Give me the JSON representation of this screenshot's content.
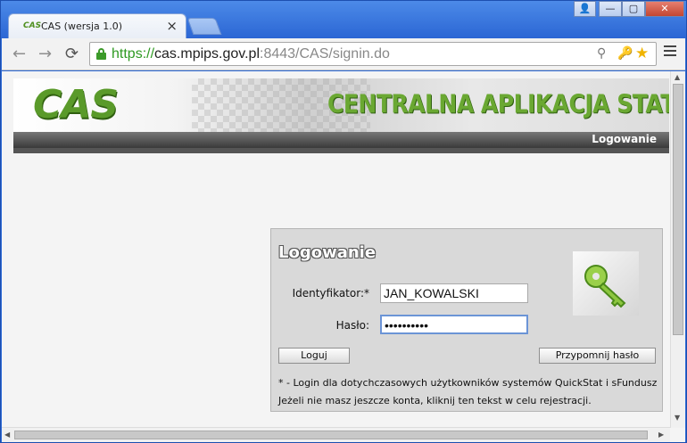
{
  "browser": {
    "tab": {
      "favicon_text": "CAS",
      "title": "CAS (wersja 1.0)",
      "close": "×"
    },
    "window_controls": {
      "user": "👤",
      "minimize": "—",
      "maximize": "▢",
      "close": "✕"
    },
    "nav": {
      "back": "←",
      "forward": "→",
      "reload": "⟳"
    },
    "url": {
      "scheme": "https://",
      "host": "cas.mpips.gov.pl",
      "rest": ":8443/CAS/signin.do"
    },
    "icons": {
      "zoom": "⚲",
      "key": "🔑",
      "star": "★"
    }
  },
  "page": {
    "logo": "CAS",
    "header_title": "CENTRALNA APLIKACJA STATYSTYCZNA",
    "header_bar_label": "Logowanie"
  },
  "login": {
    "title": "Logowanie",
    "id_label": "Identyfikator:*",
    "id_value": "JAN_KOWALSKI",
    "password_label": "Hasło:",
    "password_value": "••••••••••",
    "login_button": "Loguj",
    "remind_button": "Przypomnij hasło",
    "note_line1": "* - Login dla dotychczasowych użytkowników systemów QuickStat i sFundusz",
    "note_line2": "Jeżeli nie masz jeszcze konta, kliknij ten tekst w celu rejestracji."
  },
  "colors": {
    "brand_green": "#5a9a2a",
    "title_blue": "#2b66d4"
  }
}
